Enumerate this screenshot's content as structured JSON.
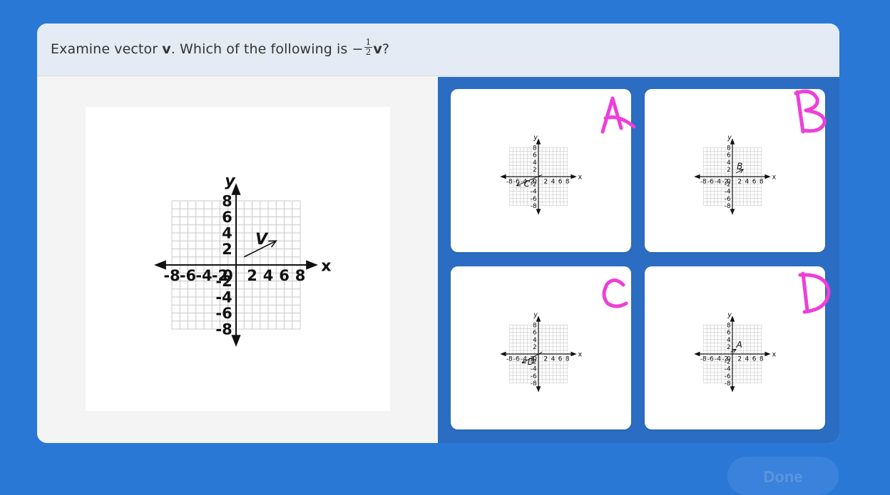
{
  "question": {
    "prefix": "Examine vector ",
    "vector_symbol": "v",
    "middle": ". Which of the following is ",
    "minus": "−",
    "frac_num": "1",
    "frac_den": "2",
    "suffix": "?"
  },
  "main_graph": {
    "ticks": [
      "-8",
      "-6",
      "-4",
      "-2",
      "0",
      "2",
      "4",
      "6",
      "8"
    ],
    "x_label": "x",
    "y_label": "y",
    "vector_label": "V"
  },
  "options": [
    {
      "handwritten": "A",
      "vector_label": "C"
    },
    {
      "handwritten": "B",
      "vector_label": "B"
    },
    {
      "handwritten": "C",
      "vector_label": "D"
    },
    {
      "handwritten": "D",
      "vector_label": "A"
    }
  ],
  "small_ticks": [
    "-8",
    "-6",
    "-4",
    "-2",
    "0",
    "2",
    "4",
    "6",
    "8"
  ],
  "done_button": "Done",
  "colors": {
    "background": "#2a78d6",
    "option_panel": "#2b6dc2",
    "annotation": "#ee3fd8"
  }
}
